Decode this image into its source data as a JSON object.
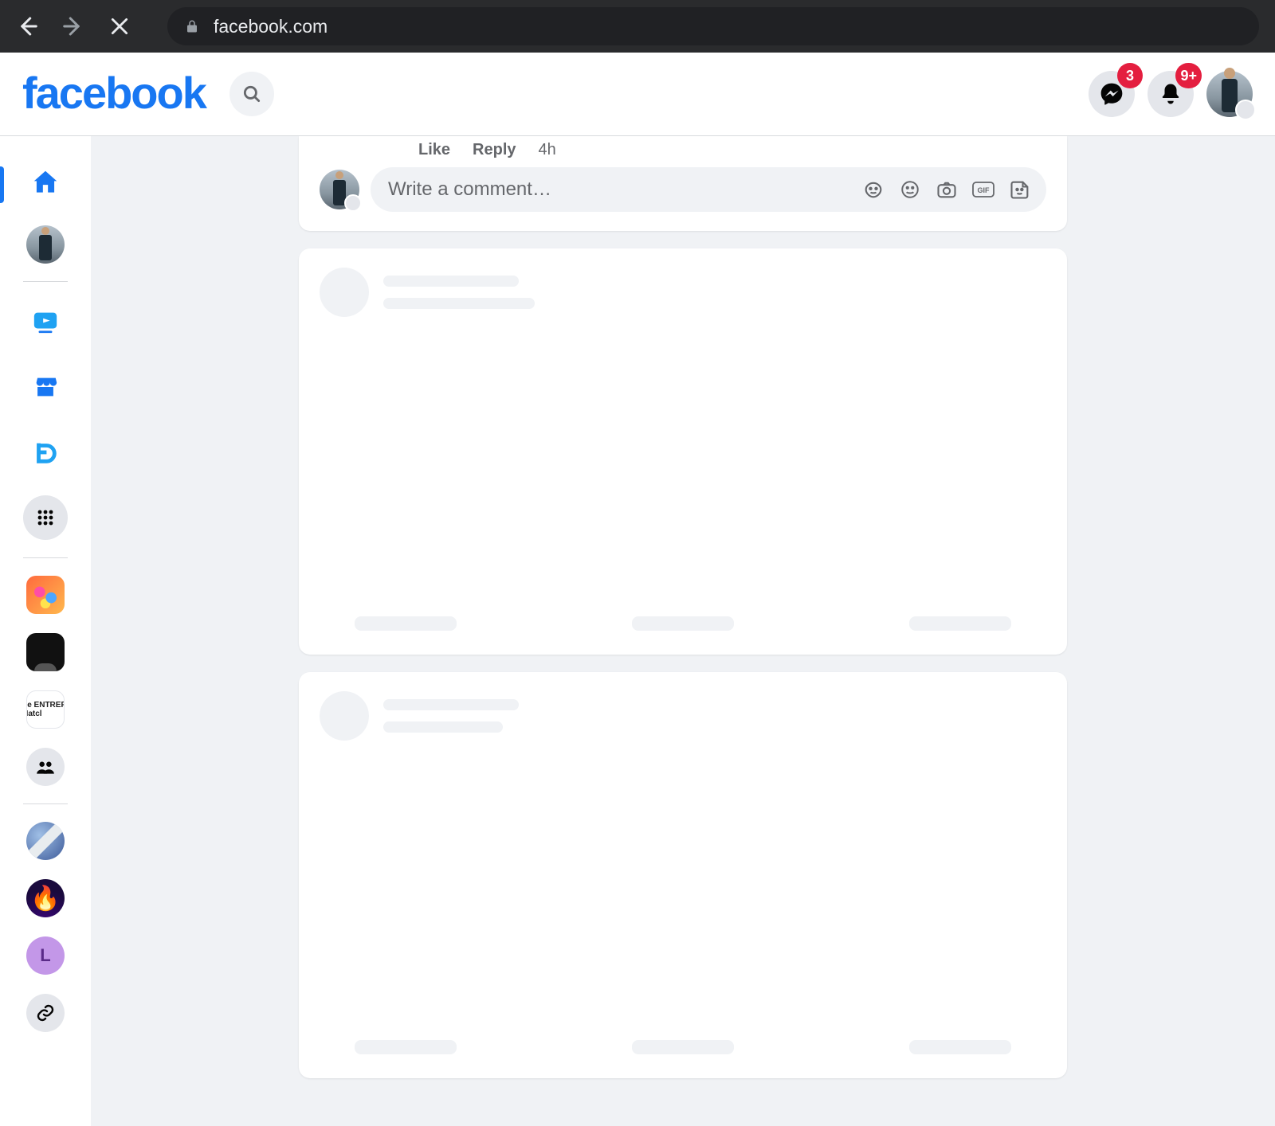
{
  "browser": {
    "url": "facebook.com"
  },
  "header": {
    "logo_text": "facebook",
    "messenger_badge": "3",
    "notifications_badge": "9+"
  },
  "comment": {
    "like_label": "Like",
    "reply_label": "Reply",
    "time": "4h",
    "composer_placeholder": "Write a comment…"
  },
  "sidebar": {
    "shortcut3_letter": "L",
    "shortcut2_text": "he ENTREPI\nHatcl"
  }
}
